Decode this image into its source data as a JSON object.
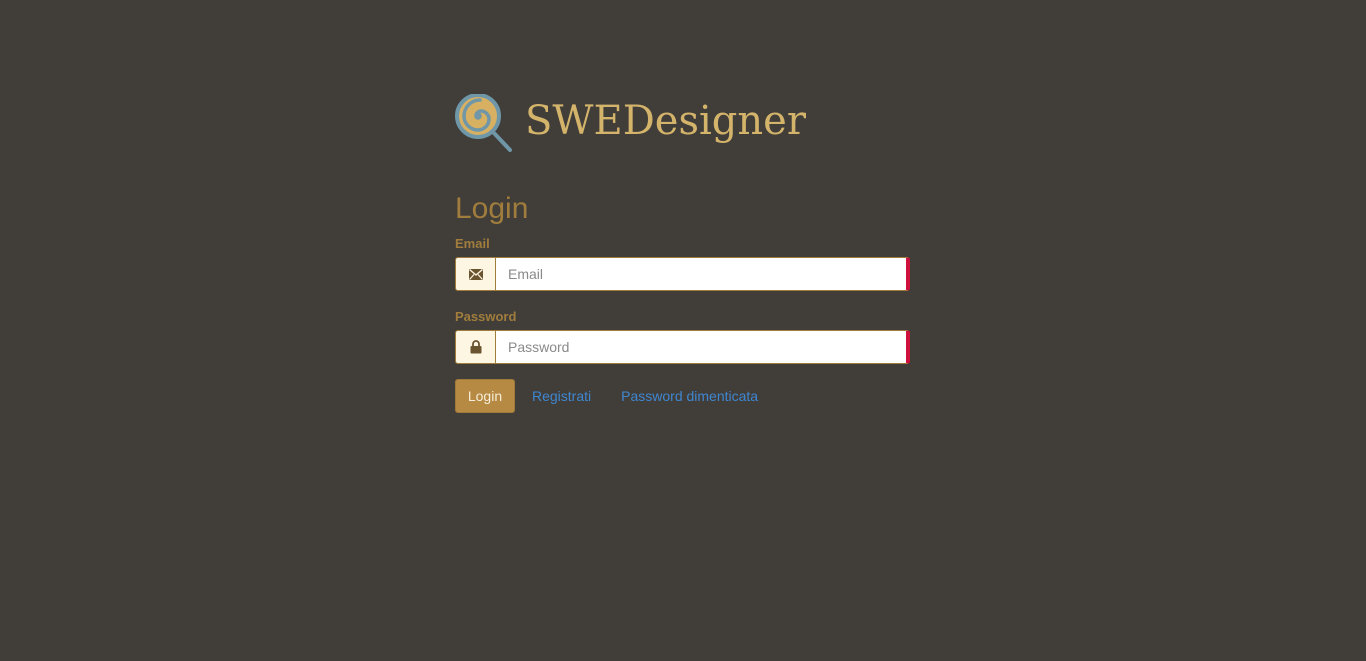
{
  "brand": {
    "name": "SWEDesigner",
    "logo_icon": "lollipop-magnifier-icon"
  },
  "login_form": {
    "title": "Login",
    "email": {
      "label": "Email",
      "placeholder": "Email",
      "value": "",
      "icon": "envelope-icon"
    },
    "password": {
      "label": "Password",
      "placeholder": "Password",
      "value": "",
      "icon": "lock-icon"
    },
    "submit_label": "Login",
    "register_link": "Registrati",
    "forgot_link": "Password dimenticata"
  },
  "colors": {
    "background": "#413e3a",
    "brand_text": "#d4b46a",
    "accent": "#a07d3c",
    "button": "#b68a42",
    "link": "#3f86d0",
    "invalid_marker": "#d0103c"
  }
}
